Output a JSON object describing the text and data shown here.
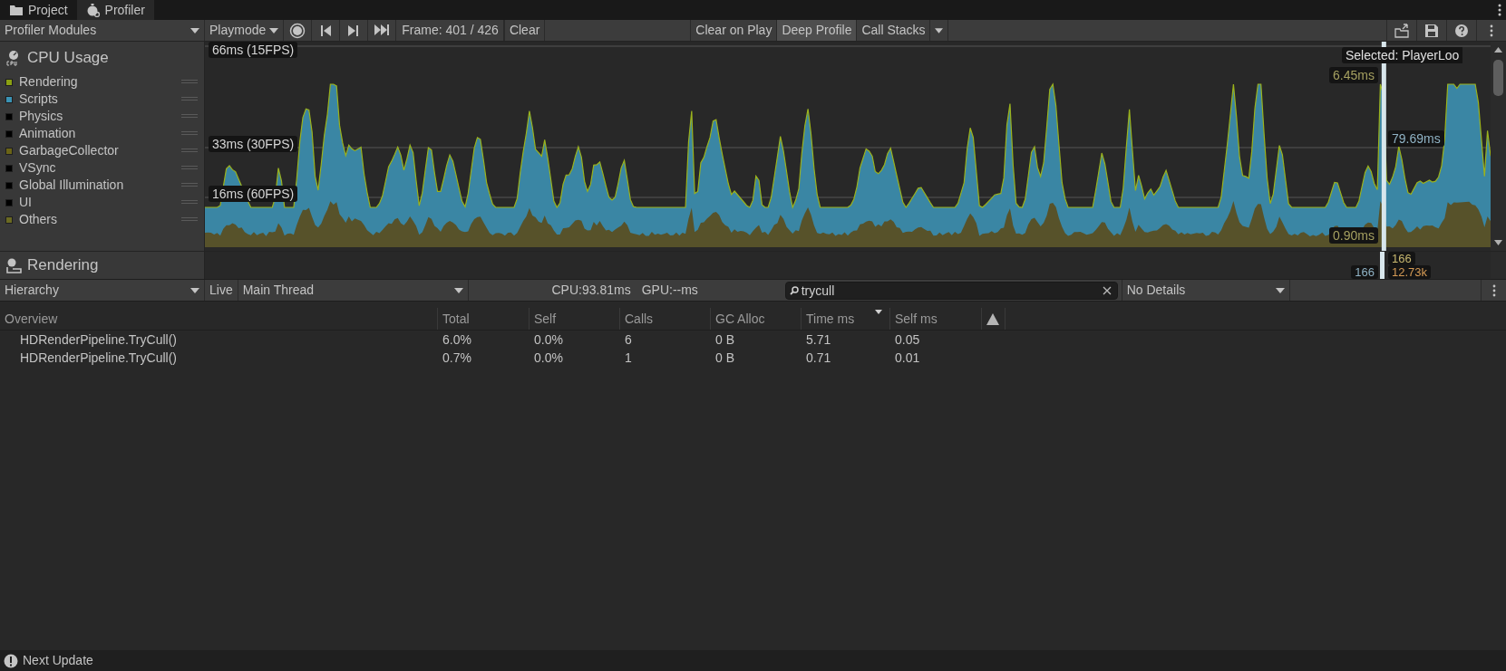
{
  "tabs": [
    {
      "label": "Project",
      "kind": "folder",
      "selected": false
    },
    {
      "label": "Profiler",
      "kind": "profiler",
      "selected": true
    }
  ],
  "toolbar": {
    "modules_dropdown": "Profiler Modules",
    "mode_dropdown": "Playmode",
    "frame": "Frame: 401 / 426",
    "clear": "Clear",
    "toggles": [
      {
        "label": "Clear on Play",
        "on": false,
        "dropdown": false
      },
      {
        "label": "Deep Profile",
        "on": true,
        "dropdown": false
      },
      {
        "label": "Call Stacks",
        "on": false,
        "dropdown": true
      }
    ]
  },
  "cpu_module": {
    "title": "CPU Usage",
    "legend": [
      {
        "name": "Rendering",
        "color": "#8aa012"
      },
      {
        "name": "Scripts",
        "color": "#3a93b5"
      },
      {
        "name": "Physics",
        "color": "#000000"
      },
      {
        "name": "Animation",
        "color": "#000000"
      },
      {
        "name": "GarbageCollector",
        "color": "#6b6416"
      },
      {
        "name": "VSync",
        "color": "#000000"
      },
      {
        "name": "Global Illumination",
        "color": "#000000"
      },
      {
        "name": "UI",
        "color": "#000000"
      },
      {
        "name": "Others",
        "color": "#6b6a22"
      }
    ],
    "threshold_labels": [
      "66ms (15FPS)",
      "33ms (30FPS)",
      "16ms (60FPS)"
    ],
    "selected_label": "Selected: PlayerLoo",
    "readings": [
      {
        "text": "6.45ms",
        "kind": "others"
      },
      {
        "text": "79.69ms",
        "kind": "scripts"
      },
      {
        "text": "0.90ms",
        "kind": "others"
      }
    ]
  },
  "rendering_module": {
    "title": "Rendering",
    "readings": [
      {
        "text": "166",
        "color": "#c8b870"
      },
      {
        "text": "166",
        "color": "#8fb2c4"
      },
      {
        "text": "12.73k",
        "color": "#d49a55"
      }
    ]
  },
  "hierarchy": {
    "view_dropdown": "Hierarchy",
    "live": "Live",
    "thread_dropdown": "Main Thread",
    "cpu": "CPU:93.81ms",
    "gpu": "GPU:--ms",
    "search": {
      "value": "trycull"
    },
    "details_dropdown": "No Details",
    "columns": [
      {
        "label": "Overview",
        "sorted": false
      },
      {
        "label": "Total",
        "sorted": false
      },
      {
        "label": "Self",
        "sorted": false
      },
      {
        "label": "Calls",
        "sorted": false
      },
      {
        "label": "GC Alloc",
        "sorted": false
      },
      {
        "label": "Time ms",
        "sorted": true
      },
      {
        "label": "Self ms",
        "sorted": false
      },
      {
        "kind": "warning",
        "sorted": false
      }
    ],
    "rows": [
      {
        "cells": [
          "HDRenderPipeline.TryCull()",
          "6.0%",
          "0.0%",
          "6",
          "0 B",
          "5.71",
          "0.05"
        ]
      },
      {
        "cells": [
          "HDRenderPipeline.TryCull()",
          "0.7%",
          "0.0%",
          "1",
          "0 B",
          "0.71",
          "0.01"
        ]
      }
    ]
  },
  "status_bar": {
    "message": "Next Update"
  }
}
